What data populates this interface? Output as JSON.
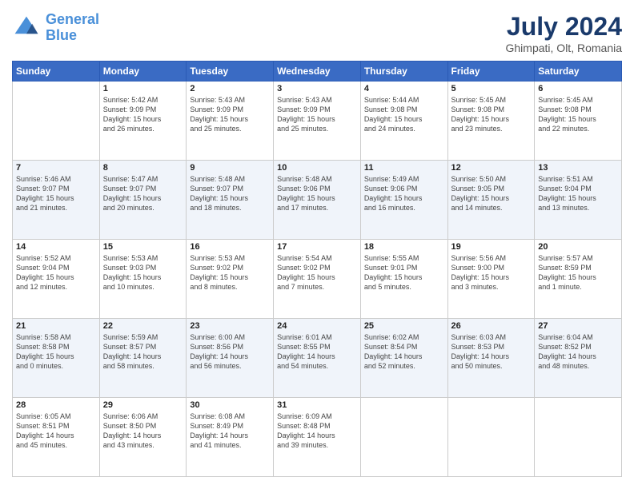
{
  "header": {
    "logo_line1": "General",
    "logo_line2": "Blue",
    "title": "July 2024",
    "subtitle": "Ghimpati, Olt, Romania"
  },
  "calendar": {
    "headers": [
      "Sunday",
      "Monday",
      "Tuesday",
      "Wednesday",
      "Thursday",
      "Friday",
      "Saturday"
    ],
    "weeks": [
      [
        {
          "day": "",
          "text": ""
        },
        {
          "day": "1",
          "text": "Sunrise: 5:42 AM\nSunset: 9:09 PM\nDaylight: 15 hours\nand 26 minutes."
        },
        {
          "day": "2",
          "text": "Sunrise: 5:43 AM\nSunset: 9:09 PM\nDaylight: 15 hours\nand 25 minutes."
        },
        {
          "day": "3",
          "text": "Sunrise: 5:43 AM\nSunset: 9:09 PM\nDaylight: 15 hours\nand 25 minutes."
        },
        {
          "day": "4",
          "text": "Sunrise: 5:44 AM\nSunset: 9:08 PM\nDaylight: 15 hours\nand 24 minutes."
        },
        {
          "day": "5",
          "text": "Sunrise: 5:45 AM\nSunset: 9:08 PM\nDaylight: 15 hours\nand 23 minutes."
        },
        {
          "day": "6",
          "text": "Sunrise: 5:45 AM\nSunset: 9:08 PM\nDaylight: 15 hours\nand 22 minutes."
        }
      ],
      [
        {
          "day": "7",
          "text": "Sunrise: 5:46 AM\nSunset: 9:07 PM\nDaylight: 15 hours\nand 21 minutes."
        },
        {
          "day": "8",
          "text": "Sunrise: 5:47 AM\nSunset: 9:07 PM\nDaylight: 15 hours\nand 20 minutes."
        },
        {
          "day": "9",
          "text": "Sunrise: 5:48 AM\nSunset: 9:07 PM\nDaylight: 15 hours\nand 18 minutes."
        },
        {
          "day": "10",
          "text": "Sunrise: 5:48 AM\nSunset: 9:06 PM\nDaylight: 15 hours\nand 17 minutes."
        },
        {
          "day": "11",
          "text": "Sunrise: 5:49 AM\nSunset: 9:06 PM\nDaylight: 15 hours\nand 16 minutes."
        },
        {
          "day": "12",
          "text": "Sunrise: 5:50 AM\nSunset: 9:05 PM\nDaylight: 15 hours\nand 14 minutes."
        },
        {
          "day": "13",
          "text": "Sunrise: 5:51 AM\nSunset: 9:04 PM\nDaylight: 15 hours\nand 13 minutes."
        }
      ],
      [
        {
          "day": "14",
          "text": "Sunrise: 5:52 AM\nSunset: 9:04 PM\nDaylight: 15 hours\nand 12 minutes."
        },
        {
          "day": "15",
          "text": "Sunrise: 5:53 AM\nSunset: 9:03 PM\nDaylight: 15 hours\nand 10 minutes."
        },
        {
          "day": "16",
          "text": "Sunrise: 5:53 AM\nSunset: 9:02 PM\nDaylight: 15 hours\nand 8 minutes."
        },
        {
          "day": "17",
          "text": "Sunrise: 5:54 AM\nSunset: 9:02 PM\nDaylight: 15 hours\nand 7 minutes."
        },
        {
          "day": "18",
          "text": "Sunrise: 5:55 AM\nSunset: 9:01 PM\nDaylight: 15 hours\nand 5 minutes."
        },
        {
          "day": "19",
          "text": "Sunrise: 5:56 AM\nSunset: 9:00 PM\nDaylight: 15 hours\nand 3 minutes."
        },
        {
          "day": "20",
          "text": "Sunrise: 5:57 AM\nSunset: 8:59 PM\nDaylight: 15 hours\nand 1 minute."
        }
      ],
      [
        {
          "day": "21",
          "text": "Sunrise: 5:58 AM\nSunset: 8:58 PM\nDaylight: 15 hours\nand 0 minutes."
        },
        {
          "day": "22",
          "text": "Sunrise: 5:59 AM\nSunset: 8:57 PM\nDaylight: 14 hours\nand 58 minutes."
        },
        {
          "day": "23",
          "text": "Sunrise: 6:00 AM\nSunset: 8:56 PM\nDaylight: 14 hours\nand 56 minutes."
        },
        {
          "day": "24",
          "text": "Sunrise: 6:01 AM\nSunset: 8:55 PM\nDaylight: 14 hours\nand 54 minutes."
        },
        {
          "day": "25",
          "text": "Sunrise: 6:02 AM\nSunset: 8:54 PM\nDaylight: 14 hours\nand 52 minutes."
        },
        {
          "day": "26",
          "text": "Sunrise: 6:03 AM\nSunset: 8:53 PM\nDaylight: 14 hours\nand 50 minutes."
        },
        {
          "day": "27",
          "text": "Sunrise: 6:04 AM\nSunset: 8:52 PM\nDaylight: 14 hours\nand 48 minutes."
        }
      ],
      [
        {
          "day": "28",
          "text": "Sunrise: 6:05 AM\nSunset: 8:51 PM\nDaylight: 14 hours\nand 45 minutes."
        },
        {
          "day": "29",
          "text": "Sunrise: 6:06 AM\nSunset: 8:50 PM\nDaylight: 14 hours\nand 43 minutes."
        },
        {
          "day": "30",
          "text": "Sunrise: 6:08 AM\nSunset: 8:49 PM\nDaylight: 14 hours\nand 41 minutes."
        },
        {
          "day": "31",
          "text": "Sunrise: 6:09 AM\nSunset: 8:48 PM\nDaylight: 14 hours\nand 39 minutes."
        },
        {
          "day": "",
          "text": ""
        },
        {
          "day": "",
          "text": ""
        },
        {
          "day": "",
          "text": ""
        }
      ]
    ]
  }
}
